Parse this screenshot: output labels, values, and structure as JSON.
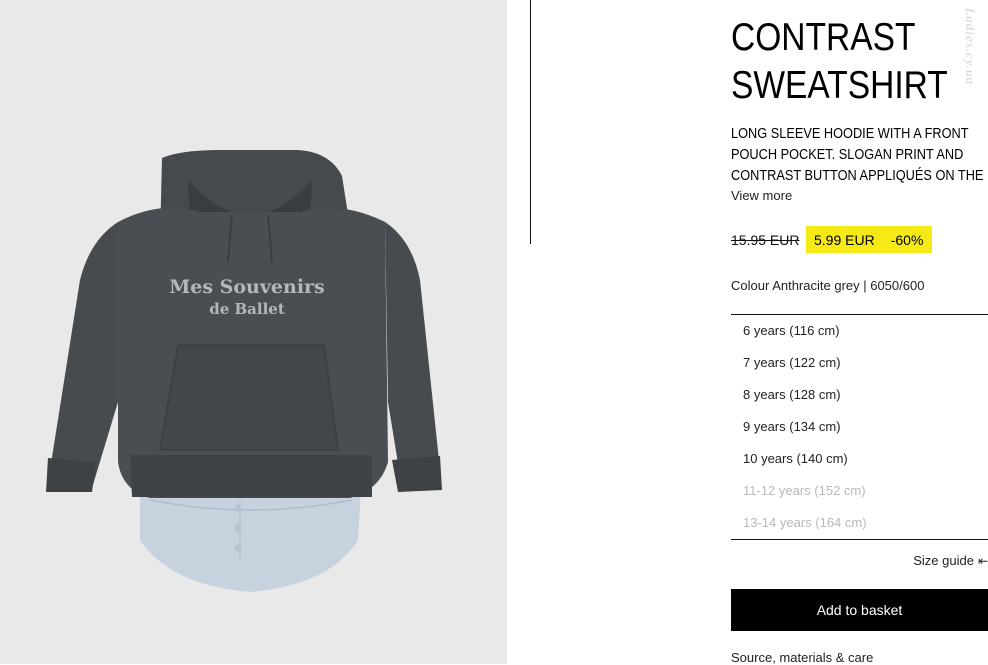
{
  "product": {
    "title_line1": "CONTRAST",
    "title_line2": "SWEATSHIRT",
    "description": "LONG SLEEVE HOODIE WITH A FRONT POUCH POCKET. SLOGAN PRINT AND CONTRAST BUTTON APPLIQUÉS ON THE",
    "view_more": "View more",
    "print_line1": "Mes Souvenirs",
    "print_line2": "de Ballet"
  },
  "price": {
    "old": "15.95 EUR",
    "new": "5.99 EUR",
    "discount": "-60%",
    "highlight_color": "#f5ea16"
  },
  "colour": "Colour Anthracite grey | 6050/600",
  "sizes": [
    {
      "label": "6 years (116 cm)",
      "available": true
    },
    {
      "label": "7 years (122 cm)",
      "available": true
    },
    {
      "label": "8 years (128 cm)",
      "available": true
    },
    {
      "label": "9 years (134 cm)",
      "available": true
    },
    {
      "label": "10 years (140 cm)",
      "available": true
    },
    {
      "label": "11-12 years (152 cm)",
      "available": false
    },
    {
      "label": "13-14 years (164 cm)",
      "available": false
    }
  ],
  "size_guide": "Size guide",
  "add_to_basket": "Add to basket",
  "source_link": "Source, materials & care",
  "watermark": "Ladies.cy.ua"
}
